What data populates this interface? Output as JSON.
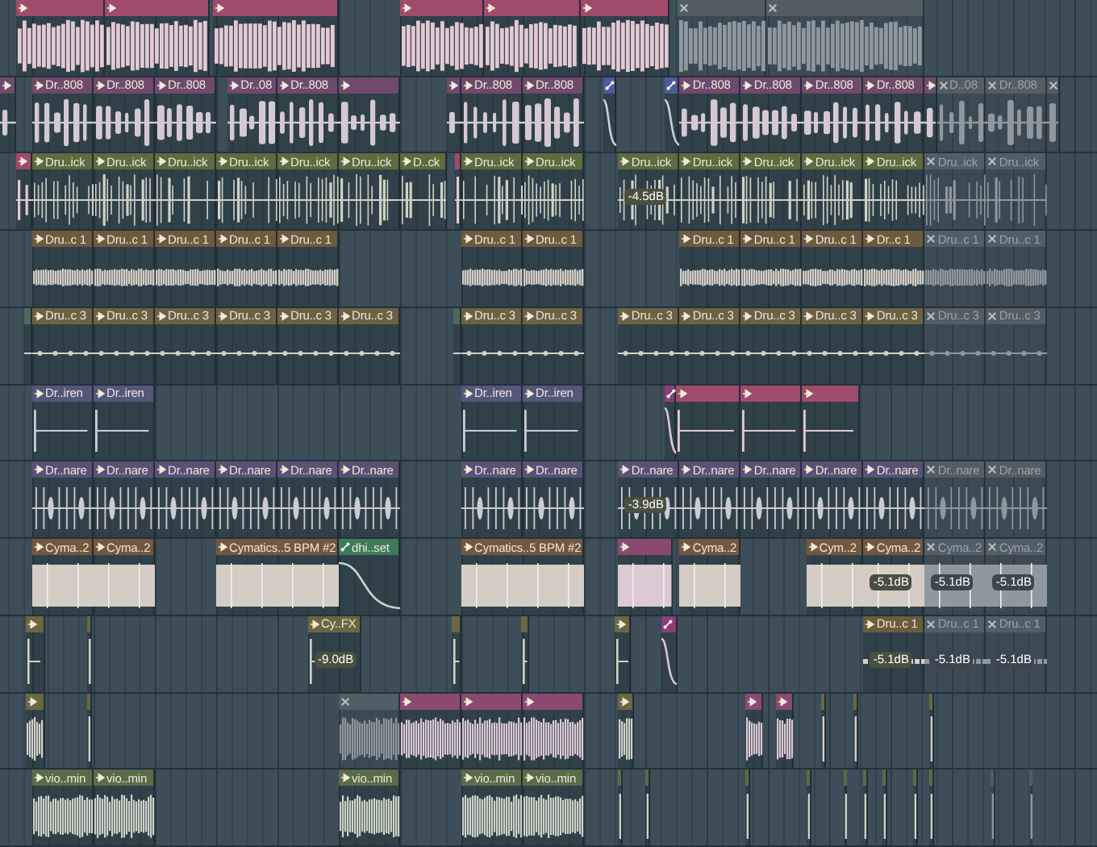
{
  "tracks": [
    {
      "color": "#a04a6c",
      "kind": "bursts",
      "clips": [
        {
          "kind": "audio",
          "muted": false
        },
        {
          "kind": "audio",
          "muted": false
        },
        {
          "kind": "audio",
          "muted": false
        },
        {
          "kind": "audio",
          "muted": false
        },
        {
          "kind": "audio",
          "muted": false
        },
        {
          "kind": "audio",
          "muted": false
        },
        {
          "kind": "audio",
          "muted": true
        },
        {
          "kind": "audio",
          "muted": true
        }
      ]
    },
    {
      "color": "#6f4a6c",
      "kind": "blocks",
      "clips": [
        {
          "kind": "audio",
          "muted": false
        },
        {
          "label": "Dr..808",
          "kind": "audio",
          "muted": false
        },
        {
          "label": "Dr..808",
          "kind": "audio",
          "muted": false
        },
        {
          "label": "Dr..808",
          "kind": "audio",
          "muted": false
        },
        {
          "label": "Dr..08",
          "kind": "audio",
          "muted": false
        },
        {
          "label": "Dr..808",
          "kind": "audio",
          "muted": false
        },
        {
          "kind": "audio",
          "muted": false
        },
        {
          "kind": "audio",
          "muted": false
        },
        {
          "label": "Dr..808",
          "kind": "audio",
          "muted": false
        },
        {
          "label": "Dr..808",
          "kind": "audio",
          "muted": false
        },
        {
          "kind": "automation",
          "muted": false,
          "color": "#4e5a9a"
        },
        {
          "kind": "automation",
          "muted": false,
          "color": "#4e5a9a"
        },
        {
          "label": "Dr..808",
          "kind": "audio",
          "muted": false
        },
        {
          "label": "Dr..808",
          "kind": "audio",
          "muted": false
        },
        {
          "label": "Dr..808",
          "kind": "audio",
          "muted": false
        },
        {
          "label": "Dr..808",
          "kind": "audio",
          "muted": false
        },
        {
          "kind": "audio",
          "muted": false
        },
        {
          "label": "D..08",
          "kind": "audio",
          "muted": true
        },
        {
          "label": "Dr..808",
          "kind": "audio",
          "muted": true
        },
        {
          "kind": "audio",
          "muted": true
        }
      ]
    },
    {
      "color": "#5e6a3f",
      "kind": "hits",
      "clips": [
        {
          "kind": "audio",
          "muted": false,
          "color": "#a04a6c"
        },
        {
          "label": "Dru..ick",
          "kind": "audio",
          "muted": false
        },
        {
          "label": "Dru..ick",
          "kind": "audio",
          "muted": false
        },
        {
          "label": "Dru..ick",
          "kind": "audio",
          "muted": false
        },
        {
          "label": "Dru..ick",
          "kind": "audio",
          "muted": false
        },
        {
          "label": "Dru..ick",
          "kind": "audio",
          "muted": false
        },
        {
          "label": "Dru..ick",
          "kind": "audio",
          "muted": false
        },
        {
          "label": "D..ck",
          "kind": "audio",
          "muted": false
        },
        {
          "kind": "audio",
          "muted": false,
          "color": "#a04a6c"
        },
        {
          "label": "Dru..ick",
          "kind": "audio",
          "muted": false
        },
        {
          "label": "Dru..ick",
          "kind": "audio",
          "muted": false
        },
        {
          "label": "Dru..ick",
          "kind": "audio",
          "muted": false,
          "gain": "-4.5dB"
        },
        {
          "label": "Dru..ick",
          "kind": "audio",
          "muted": false
        },
        {
          "label": "Dru..ick",
          "kind": "audio",
          "muted": false
        },
        {
          "label": "Dru..ick",
          "kind": "audio",
          "muted": false
        },
        {
          "label": "Dru..ick",
          "kind": "audio",
          "muted": false
        },
        {
          "label": "Dru..ick",
          "kind": "audio",
          "muted": true
        },
        {
          "label": "Dru..ick",
          "kind": "audio",
          "muted": true
        }
      ]
    },
    {
      "color": "#6d5b3e",
      "kind": "noise",
      "clips": [
        {
          "label": "Dru..c 1",
          "kind": "audio",
          "muted": false
        },
        {
          "label": "Dru..c 1",
          "kind": "audio",
          "muted": false
        },
        {
          "label": "Dru..c 1",
          "kind": "audio",
          "muted": false
        },
        {
          "label": "Dru..c 1",
          "kind": "audio",
          "muted": false
        },
        {
          "label": "Dru..c 1",
          "kind": "audio",
          "muted": false
        },
        {
          "label": "Dru..c 1",
          "kind": "audio",
          "muted": false
        },
        {
          "label": "Dru..c 1",
          "kind": "audio",
          "muted": false
        },
        {
          "label": "Dru..c 1",
          "kind": "audio",
          "muted": false
        },
        {
          "label": "Dru..c 1",
          "kind": "audio",
          "muted": false
        },
        {
          "label": "Dru..c 1",
          "kind": "audio",
          "muted": false
        },
        {
          "label": "Dr..c 1",
          "kind": "audio",
          "muted": false
        },
        {
          "label": "Dru..c 1",
          "kind": "audio",
          "muted": true
        },
        {
          "label": "Dru..c 1",
          "kind": "audio",
          "muted": true
        }
      ]
    },
    {
      "color": "#6a6243",
      "kind": "dotline",
      "clips": [
        {
          "kind": "audio",
          "muted": false,
          "color": "#4d6a5a"
        },
        {
          "label": "Dru..c 3",
          "kind": "audio",
          "muted": false
        },
        {
          "label": "Dru..c 3",
          "kind": "audio",
          "muted": false
        },
        {
          "label": "Dru..c 3",
          "kind": "audio",
          "muted": false
        },
        {
          "label": "Dru..c 3",
          "kind": "audio",
          "muted": false
        },
        {
          "label": "Dru..c 3",
          "kind": "audio",
          "muted": false
        },
        {
          "label": "Dru..c 3",
          "kind": "audio",
          "muted": false
        },
        {
          "kind": "audio",
          "muted": false,
          "color": "#4d6a5a"
        },
        {
          "label": "Dru..c 3",
          "kind": "audio",
          "muted": false
        },
        {
          "label": "Dru..c 3",
          "kind": "audio",
          "muted": false
        },
        {
          "label": "Dru..c 3",
          "kind": "audio",
          "muted": false
        },
        {
          "label": "Dru..c 3",
          "kind": "audio",
          "muted": false
        },
        {
          "label": "Dru..c 3",
          "kind": "audio",
          "muted": false
        },
        {
          "label": "Dru..c 3",
          "kind": "audio",
          "muted": false
        },
        {
          "label": "Dru..c 3",
          "kind": "audio",
          "muted": false
        },
        {
          "label": "Dru..c 3",
          "kind": "audio",
          "muted": true
        },
        {
          "label": "Dru..c 3",
          "kind": "audio",
          "muted": true
        }
      ]
    },
    {
      "color": "#56567a",
      "kind": "spike",
      "clips": [
        {
          "label": "Dr..iren",
          "kind": "audio",
          "muted": false
        },
        {
          "label": "Dr..iren",
          "kind": "audio",
          "muted": false
        },
        {
          "label": "Dr..iren",
          "kind": "audio",
          "muted": false
        },
        {
          "label": "Dr..iren",
          "kind": "audio",
          "muted": false
        },
        {
          "kind": "automation",
          "muted": false,
          "color": "#8a3f7a"
        },
        {
          "kind": "audio",
          "muted": false,
          "color": "#a04a6c"
        },
        {
          "kind": "audio",
          "muted": false,
          "color": "#a04a6c"
        },
        {
          "kind": "audio",
          "muted": false,
          "color": "#a04a6c"
        }
      ]
    },
    {
      "color": "#5a5174",
      "kind": "snare",
      "clips": [
        {
          "label": "Dr..nare",
          "kind": "audio",
          "muted": false
        },
        {
          "label": "Dr..nare",
          "kind": "audio",
          "muted": false
        },
        {
          "label": "Dr..nare",
          "kind": "audio",
          "muted": false
        },
        {
          "label": "Dr..nare",
          "kind": "audio",
          "muted": false
        },
        {
          "label": "Dr..nare",
          "kind": "audio",
          "muted": false
        },
        {
          "label": "Dr..nare",
          "kind": "audio",
          "muted": false
        },
        {
          "label": "Dr..nare",
          "kind": "audio",
          "muted": false
        },
        {
          "label": "Dr..nare",
          "kind": "audio",
          "muted": false
        },
        {
          "label": "Dr..nare",
          "kind": "audio",
          "muted": false,
          "gain": "-3.9dB"
        },
        {
          "label": "Dr..nare",
          "kind": "audio",
          "muted": false
        },
        {
          "label": "Dr..nare",
          "kind": "audio",
          "muted": false
        },
        {
          "label": "Dr..nare",
          "kind": "audio",
          "muted": false
        },
        {
          "label": "Dr..nare",
          "kind": "audio",
          "muted": false
        },
        {
          "label": "Dr..nare",
          "kind": "audio",
          "muted": true
        },
        {
          "label": "Dr..nare",
          "kind": "audio",
          "muted": true
        }
      ]
    },
    {
      "color": "#74573f",
      "kind": "pad",
      "clips": [
        {
          "label": "Cyma..2",
          "kind": "audio",
          "muted": false
        },
        {
          "label": "Cyma..2",
          "kind": "audio",
          "muted": false
        },
        {
          "label": "Cymatics..5 BPM #2",
          "kind": "audio",
          "muted": false
        },
        {
          "label": "dhi..set",
          "kind": "automation",
          "muted": false,
          "color": "#3f7a5a"
        },
        {
          "label": "Cymatics..5 BPM #2",
          "kind": "audio",
          "muted": false
        },
        {
          "kind": "audio",
          "muted": false,
          "color": "#8a4a70"
        },
        {
          "label": "Cyma..2",
          "kind": "audio",
          "muted": false
        },
        {
          "label": "Cym..2",
          "kind": "audio",
          "muted": false
        },
        {
          "label": "Cyma..2",
          "kind": "audio",
          "muted": false,
          "gain": "-5.1dB"
        },
        {
          "label": "Cyma..2",
          "kind": "audio",
          "muted": true,
          "gain": "-5.1dB"
        },
        {
          "label": "Cyma..2",
          "kind": "audio",
          "muted": true,
          "gain": "-5.1dB"
        }
      ]
    },
    {
      "color": "#6b6741",
      "kind": "tick",
      "clips": [
        {
          "kind": "audio",
          "muted": false
        },
        {
          "kind": "audio",
          "muted": false
        },
        {
          "label": "Cy..FX",
          "kind": "audio",
          "muted": false,
          "gain": "-9.0dB"
        },
        {
          "kind": "audio",
          "muted": false
        },
        {
          "kind": "audio",
          "muted": false
        },
        {
          "kind": "audio",
          "muted": false
        },
        {
          "kind": "automation",
          "muted": false,
          "color": "#8a3f7a"
        },
        {
          "label": "Dru..c 1",
          "kind": "audio",
          "muted": false,
          "color": "#6d5b3e",
          "gain": "-5.1dB"
        },
        {
          "label": "Dru..c 1",
          "kind": "audio",
          "muted": true,
          "gain": "-5.1dB"
        },
        {
          "label": "Dru..c 1",
          "kind": "audio",
          "muted": true,
          "gain": "-5.1dB"
        }
      ]
    },
    {
      "color": "#8a4a72",
      "kind": "dense",
      "clips": [
        {
          "kind": "audio",
          "muted": false,
          "color": "#6b6741"
        },
        {
          "kind": "audio",
          "muted": false,
          "color": "#6b6741"
        },
        {
          "kind": "audio",
          "muted": true
        },
        {
          "kind": "audio",
          "muted": false
        },
        {
          "kind": "audio",
          "muted": false
        },
        {
          "kind": "audio",
          "muted": false
        },
        {
          "kind": "audio",
          "muted": false,
          "color": "#6b6741"
        },
        {
          "kind": "audio",
          "muted": false
        },
        {
          "kind": "audio",
          "muted": false
        },
        {
          "kind": "audio",
          "muted": false,
          "color": "#6b6741"
        },
        {
          "kind": "audio",
          "muted": false,
          "color": "#6b6741"
        },
        {
          "kind": "audio",
          "muted": false,
          "color": "#6b6741"
        }
      ]
    },
    {
      "color": "#5a6b48",
      "kind": "dense",
      "clips": [
        {
          "label": "vio..min",
          "kind": "audio",
          "muted": false
        },
        {
          "label": "vio..min",
          "kind": "audio",
          "muted": false
        },
        {
          "label": "vio..min",
          "kind": "audio",
          "muted": false
        },
        {
          "label": "vio..min",
          "kind": "audio",
          "muted": false
        },
        {
          "label": "vio..min",
          "kind": "audio",
          "muted": false
        },
        {
          "kind": "audio",
          "muted": false
        },
        {
          "kind": "audio",
          "muted": false
        },
        {
          "kind": "audio",
          "muted": false
        },
        {
          "kind": "audio",
          "muted": false
        },
        {
          "kind": "audio",
          "muted": false
        },
        {
          "kind": "audio",
          "muted": false
        },
        {
          "kind": "audio",
          "muted": false
        },
        {
          "kind": "audio",
          "muted": false
        },
        {
          "kind": "audio",
          "muted": false
        },
        {
          "kind": "audio",
          "muted": true
        },
        {
          "kind": "audio",
          "muted": true
        }
      ]
    }
  ]
}
